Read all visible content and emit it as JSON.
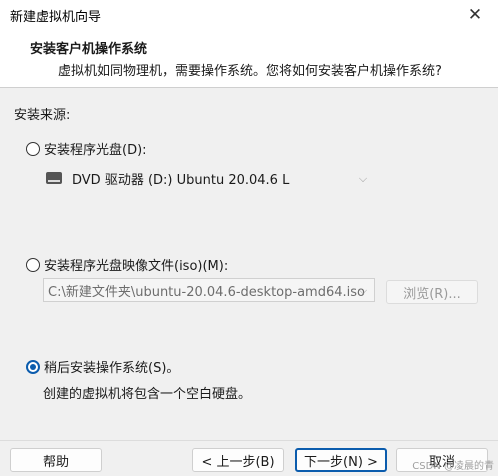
{
  "window": {
    "title": "新建虚拟机向导",
    "close_glyph": "✕"
  },
  "header": {
    "title": "安装客户机操作系统",
    "subtitle": "虚拟机如同物理机，需要操作系统。您将如何安装客户机操作系统?"
  },
  "install_source": {
    "label": "安装来源:",
    "option_disc": {
      "label": "安装程序光盘(D):",
      "selected": false,
      "drive_value": "DVD 驱动器 (D:) Ubuntu 20.04.6 L"
    },
    "option_iso": {
      "label": "安装程序光盘映像文件(iso)(M):",
      "selected": false,
      "path_value": "C:\\新建文件夹\\ubuntu-20.04.6-desktop-amd64.iso",
      "browse_label": "浏览(R)..."
    },
    "option_later": {
      "label": "稍后安装操作系统(S)。",
      "selected": true,
      "note": "创建的虚拟机将包含一个空白硬盘。"
    }
  },
  "footer": {
    "help_label": "帮助",
    "back_label": "< 上一步(B)",
    "next_label": "下一步(N) >",
    "cancel_label": "取消"
  },
  "watermark": "CSDN @凌晨的青"
}
